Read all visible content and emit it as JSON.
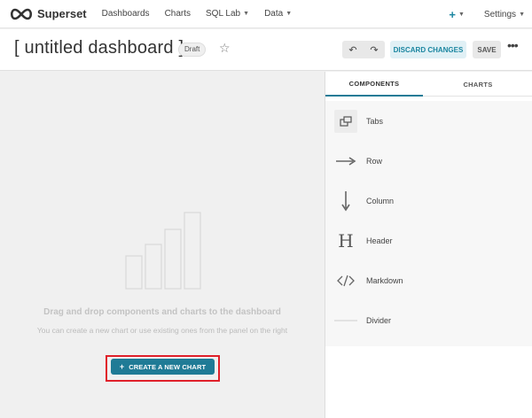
{
  "nav": {
    "brand": "Superset",
    "items": [
      {
        "label": "Dashboards",
        "caret": false
      },
      {
        "label": "Charts",
        "caret": false
      },
      {
        "label": "SQL Lab",
        "caret": true
      },
      {
        "label": "Data",
        "caret": true
      }
    ],
    "plus": "+",
    "settings": "Settings"
  },
  "header": {
    "title": "[ untitled dashboard ]",
    "status_badge": "Draft",
    "discard_label": "DISCARD CHANGES",
    "save_label": "SAVE"
  },
  "canvas": {
    "empty_title": "Drag and drop components and charts to the dashboard",
    "empty_description": "You can create a new chart or use existing ones from the panel on the right",
    "create_button": "CREATE A NEW CHART"
  },
  "panel": {
    "tabs": [
      {
        "label": "COMPONENTS",
        "active": true
      },
      {
        "label": "CHARTS",
        "active": false
      }
    ],
    "components": [
      {
        "label": "Tabs",
        "icon": "tabs-icon"
      },
      {
        "label": "Row",
        "icon": "row-arrow-icon"
      },
      {
        "label": "Column",
        "icon": "column-arrow-icon"
      },
      {
        "label": "Header",
        "icon": "header-icon"
      },
      {
        "label": "Markdown",
        "icon": "markdown-code-icon"
      },
      {
        "label": "Divider",
        "icon": "divider-icon"
      }
    ]
  },
  "colors": {
    "accent": "#1f7b96",
    "highlight": "#e0202a",
    "discard_bg": "#e0f0f5"
  }
}
